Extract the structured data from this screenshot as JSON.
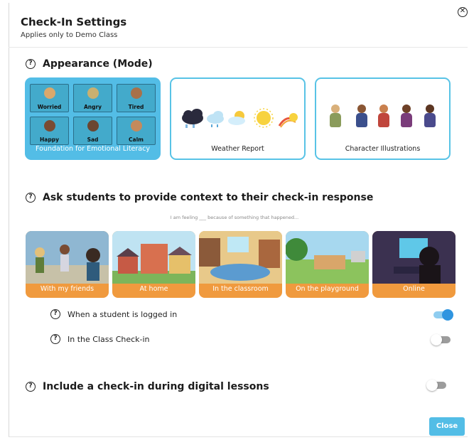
{
  "modal": {
    "title": "Check-In Settings",
    "subtitle": "Applies only to Demo Class",
    "close_icon": "close-circle-icon",
    "close_button_label": "Close"
  },
  "help_icon_glyph": "?",
  "appearance": {
    "heading": "Appearance (Mode)",
    "modes": [
      {
        "label": "Foundation for Emotional Literacy",
        "selected": true,
        "emotions": [
          "Worried",
          "Angry",
          "Tired",
          "Happy",
          "Sad",
          "Calm"
        ]
      },
      {
        "label": "Weather Report",
        "selected": false
      },
      {
        "label": "Character Illustrations",
        "selected": false
      }
    ]
  },
  "context": {
    "heading": "Ask students to provide context to their check-in response",
    "sample_sentence": "I am feeling ___ because of something that happened...",
    "locations": [
      "With my friends",
      "At home",
      "In the classroom",
      "On the playground",
      "Online"
    ],
    "options": [
      {
        "label": "When a student is logged in",
        "enabled": true
      },
      {
        "label": "In the Class Check-in",
        "enabled": false
      }
    ]
  },
  "digital_lessons": {
    "heading": "Include a check-in during digital lessons",
    "enabled": false
  },
  "colors": {
    "accent_blue": "#53bde6",
    "card_orange": "#f09a3e",
    "toggle_on": "#2f95e0"
  }
}
